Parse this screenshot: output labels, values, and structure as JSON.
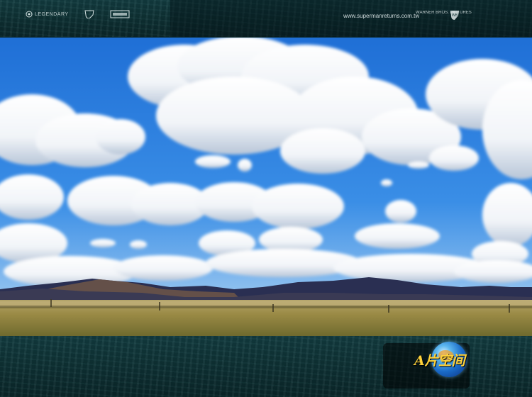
{
  "header": {
    "legendary_logo": "LEGENDARY",
    "website": "www.supermanreturns.com.tw",
    "studio_name": "WARNER BROS. PICTURES"
  },
  "scene": {
    "sky_color": "#3a87e0",
    "hills_color": "#2a2f52",
    "grass_color": "#9a8a45"
  },
  "watermark": {
    "text": "A片空间",
    "icon": "globe-icon"
  }
}
